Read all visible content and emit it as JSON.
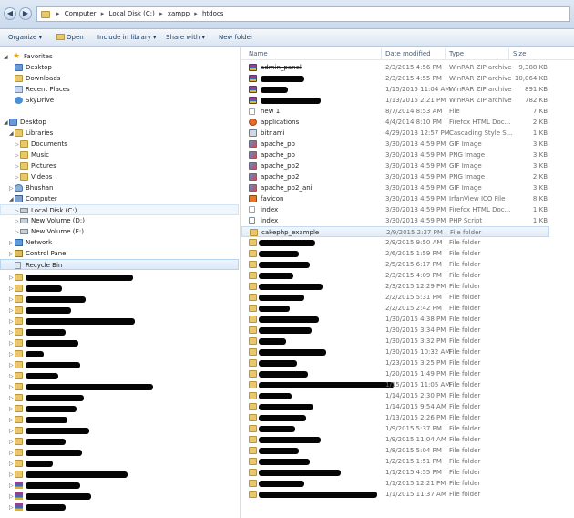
{
  "address": {
    "crumbs": [
      "Computer",
      "Local Disk (C:)",
      "xampp",
      "htdocs"
    ]
  },
  "toolbar": {
    "organize": "Organize ▾",
    "open": "Open",
    "include_in_library": "Include in library ▾",
    "share_with": "Share with ▾",
    "new_folder": "New folder"
  },
  "nav": {
    "favorites": "Favorites",
    "desktop_fav": "Desktop",
    "downloads": "Downloads",
    "recent_places": "Recent Places",
    "skydrive": "SkyDrive",
    "desktop": "Desktop",
    "libraries": "Libraries",
    "documents": "Documents",
    "music": "Music",
    "pictures": "Pictures",
    "videos": "Videos",
    "bhushan": "Bhushan",
    "computer": "Computer",
    "local_disk": "Local Disk (C:)",
    "new_volume_d": "New Volume (D:)",
    "new_volume_e": "New Volume (E:)",
    "network": "Network",
    "control_panel": "Control Panel",
    "recycle_bin": "Recycle Bin"
  },
  "columns": {
    "name": "Name",
    "date": "Date modified",
    "type": "Type",
    "size": "Size"
  },
  "files": {
    "f0": {
      "name": "admin_panel",
      "date": "2/3/2015 4:56 PM",
      "type": "WinRAR ZIP archive",
      "size": "9,388 KB"
    },
    "f1": {
      "name": "",
      "date": "2/3/2015 4:55 PM",
      "type": "WinRAR ZIP archive",
      "size": "10,064 KB"
    },
    "f2": {
      "name": "",
      "date": "1/15/2015 11:04 AM",
      "type": "WinRAR ZIP archive",
      "size": "891 KB"
    },
    "f3": {
      "name": "",
      "date": "1/13/2015 2:21 PM",
      "type": "WinRAR ZIP archive",
      "size": "782 KB"
    },
    "f4": {
      "name": "new 1",
      "date": "8/7/2014 8:53 AM",
      "type": "File",
      "size": "7 KB"
    },
    "f5": {
      "name": "applications",
      "date": "4/4/2014 8:10 PM",
      "type": "Firefox HTML Doc...",
      "size": "2 KB"
    },
    "f6": {
      "name": "bitnami",
      "date": "4/29/2013 12:57 PM",
      "type": "Cascading Style S...",
      "size": "1 KB"
    },
    "f7": {
      "name": "apache_pb",
      "date": "3/30/2013 4:59 PM",
      "type": "GIF Image",
      "size": "3 KB"
    },
    "f8": {
      "name": "apache_pb",
      "date": "3/30/2013 4:59 PM",
      "type": "PNG Image",
      "size": "3 KB"
    },
    "f9": {
      "name": "apache_pb2",
      "date": "3/30/2013 4:59 PM",
      "type": "GIF Image",
      "size": "3 KB"
    },
    "f10": {
      "name": "apache_pb2",
      "date": "3/30/2013 4:59 PM",
      "type": "PNG Image",
      "size": "2 KB"
    },
    "f11": {
      "name": "apache_pb2_ani",
      "date": "3/30/2013 4:59 PM",
      "type": "GIF Image",
      "size": "3 KB"
    },
    "f12": {
      "name": "favicon",
      "date": "3/30/2013 4:59 PM",
      "type": "IrfanView ICO File",
      "size": "8 KB"
    },
    "f13": {
      "name": "index",
      "date": "3/30/2013 4:59 PM",
      "type": "Firefox HTML Doc...",
      "size": "1 KB"
    },
    "f14": {
      "name": "index",
      "date": "3/30/2013 4:59 PM",
      "type": "PHP Script",
      "size": "1 KB"
    },
    "f15": {
      "name": "cakephp_example",
      "date": "2/9/2015 2:37 PM",
      "type": "File folder",
      "size": ""
    }
  },
  "folder_rows": [
    {
      "date": "2/9/2015 9:50 AM",
      "type": "File folder"
    },
    {
      "date": "2/6/2015 1:59 PM",
      "type": "File folder"
    },
    {
      "date": "2/5/2015 6:17 PM",
      "type": "File folder"
    },
    {
      "date": "2/3/2015 4:09 PM",
      "type": "File folder"
    },
    {
      "date": "2/3/2015 12:29 PM",
      "type": "File folder"
    },
    {
      "date": "2/2/2015 5:31 PM",
      "type": "File folder"
    },
    {
      "date": "2/2/2015 2:42 PM",
      "type": "File folder"
    },
    {
      "date": "1/30/2015 4:38 PM",
      "type": "File folder"
    },
    {
      "date": "1/30/2015 3:34 PM",
      "type": "File folder"
    },
    {
      "date": "1/30/2015 3:32 PM",
      "type": "File folder"
    },
    {
      "date": "1/30/2015 10:32 AM",
      "type": "File folder"
    },
    {
      "date": "1/23/2015 3:25 PM",
      "type": "File folder"
    },
    {
      "date": "1/20/2015 1:49 PM",
      "type": "File folder"
    },
    {
      "date": "1/15/2015 11:05 AM",
      "type": "File folder"
    },
    {
      "date": "1/14/2015 2:30 PM",
      "type": "File folder"
    },
    {
      "date": "1/14/2015 9:54 AM",
      "type": "File folder"
    },
    {
      "date": "1/13/2015 2:26 PM",
      "type": "File folder"
    },
    {
      "date": "1/9/2015 5:37 PM",
      "type": "File folder"
    },
    {
      "date": "1/9/2015 11:04 AM",
      "type": "File folder"
    },
    {
      "date": "1/8/2015 5:04 PM",
      "type": "File folder"
    },
    {
      "date": "1/2/2015 1:51 PM",
      "type": "File folder"
    },
    {
      "date": "1/1/2015 4:55 PM",
      "type": "File folder"
    },
    {
      "date": "1/1/2015 12:21 PM",
      "type": "File folder"
    },
    {
      "date": "1/1/2015 11:37 AM",
      "type": "File folder"
    }
  ]
}
